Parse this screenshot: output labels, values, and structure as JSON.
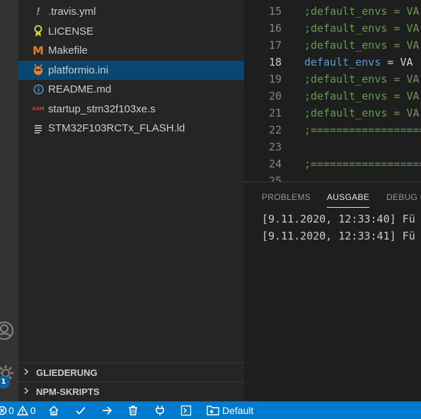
{
  "files": [
    {
      "name": ".travis.yml",
      "icon": "yaml-exclamation-icon",
      "icon_color": "#a074c4"
    },
    {
      "name": "LICENSE",
      "icon": "license-ribbon-icon",
      "icon_color": "#cbcb41"
    },
    {
      "name": "Makefile",
      "icon": "makefile-m-icon",
      "icon_color": "#e37933"
    },
    {
      "name": "platformio.ini",
      "icon": "platformio-alien-icon",
      "icon_color": "#f5822a",
      "selected": true
    },
    {
      "name": "README.md",
      "icon": "info-icon",
      "icon_color": "#519aba"
    },
    {
      "name": "startup_stm32f103xe.s",
      "icon": "asm-icon",
      "icon_color": "#cc3e44",
      "icon_text": "ASM"
    },
    {
      "name": "STM32F103RCTx_FLASH.ld",
      "icon": "text-lines-icon",
      "icon_color": "#cccccc"
    }
  ],
  "sidebar_panels": {
    "outline": "GLIEDERUNG",
    "npm_scripts": "NPM-SKRIPTS"
  },
  "activity_bar": {
    "badge": "1"
  },
  "editor": {
    "lines": [
      {
        "num": "15",
        "text": ";default_envs = VA",
        "kind": "comment"
      },
      {
        "num": "16",
        "text": ";default_envs = VA",
        "kind": "comment"
      },
      {
        "num": "17",
        "text": ";default_envs = VA",
        "kind": "comment"
      },
      {
        "num": "18",
        "key": "default_envs",
        "op": " = ",
        "val": "VA",
        "kind": "setting"
      },
      {
        "num": "19",
        "text": ";default_envs = VA",
        "kind": "comment"
      },
      {
        "num": "20",
        "text": ";default_envs = VA",
        "kind": "comment"
      },
      {
        "num": "21",
        "text": ";default_envs = VA",
        "kind": "comment"
      },
      {
        "num": "22",
        "text": ";==================",
        "kind": "comment"
      },
      {
        "num": "23",
        "text": "",
        "kind": "blank"
      },
      {
        "num": "24",
        "text": ";==================",
        "kind": "comment"
      },
      {
        "num": "25",
        "text": "",
        "kind": "blank"
      }
    ]
  },
  "panel": {
    "tabs": [
      "PROBLEMS",
      "AUSGABE",
      "DEBUG C"
    ],
    "active_tab": "AUSGABE",
    "output": [
      "[9.11.2020, 12:33:40] Fü",
      "[9.11.2020, 12:33:41] Fü"
    ]
  },
  "status_bar": {
    "errors": "0",
    "warnings": "0",
    "env_label": "Default"
  },
  "colors": {
    "status_bar": "#007acc",
    "selection": "#094771",
    "comment": "#6a9955",
    "keyword": "#569cd6"
  }
}
